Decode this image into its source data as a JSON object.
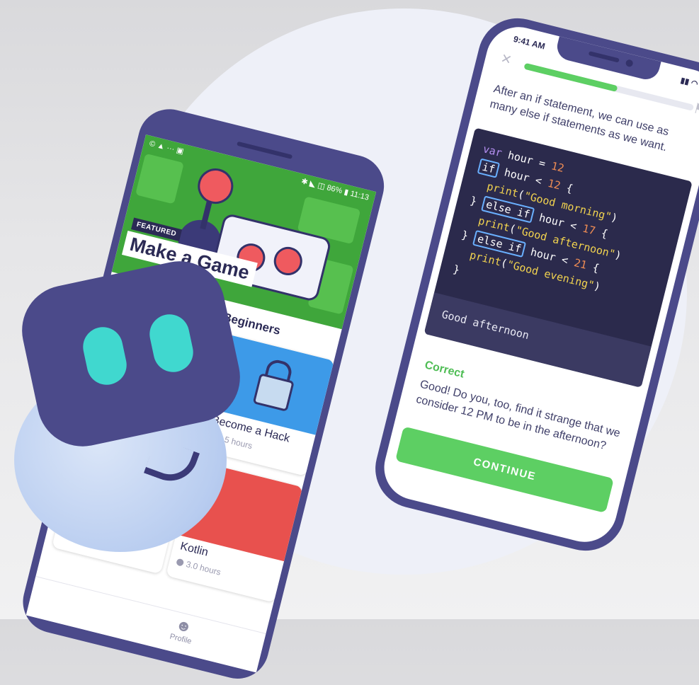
{
  "left_phone": {
    "status": {
      "left": "© ▲ ··· ▣",
      "right": "✱ ◣ ◫ 86% ▮ 11:13"
    },
    "featured": {
      "badge": "FEATURED",
      "title": "Make a Game"
    },
    "section_title": "Recommended for Beginners",
    "courses": [
      {
        "name": "",
        "hours": ""
      },
      {
        "name": "Become a Hack",
        "hours": "6.5 hours"
      },
      {
        "name": "",
        "hours": ""
      },
      {
        "name": "Kotlin",
        "hours": "3.0 hours"
      }
    ],
    "tabbar": {
      "profile_label": "Profile"
    }
  },
  "right_phone": {
    "time": "9:41 AM",
    "progress": 0.55,
    "instruction": "After an if statement, we can use as many else if statements as we want.",
    "code": {
      "kw_var": "var",
      "kw_if": "if",
      "kw_else_if": "else if",
      "fn_print": "print",
      "var_name": "hour",
      "num_12": "12",
      "num_17": "17",
      "num_21": "21",
      "str_morning": "\"Good morning\"",
      "str_afternoon": "\"Good afternoon\"",
      "str_evening": "\"Good evening\""
    },
    "output": "Good afternoon",
    "result_title": "Correct",
    "feedback": "Good! Do you, too, find it strange that we consider 12 PM to be in the afternoon?",
    "continue_label": "CONTINUE"
  },
  "colors": {
    "accent_green": "#5dcf63",
    "brand_purple": "#4b4a8a",
    "code_bg": "#2b2a4c",
    "mascot_eye": "#40d8cf"
  },
  "icons": [
    "close-icon",
    "flag-icon",
    "clock-icon",
    "profile-icon",
    "signal-icon",
    "wifi-icon",
    "battery-icon"
  ]
}
